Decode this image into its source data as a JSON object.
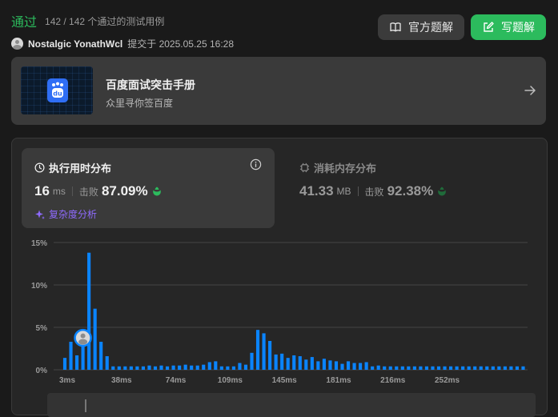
{
  "header": {
    "status": "通过",
    "passed_cases": "142 / 142 个通过的测试用例",
    "username": "Nostalgic YonathWcl",
    "submitted_at": "提交于 2025.05.25 16:28",
    "official_solution_label": "官方题解",
    "write_solution_label": "写题解"
  },
  "banner": {
    "title": "百度面试突击手册",
    "subtitle": "众里寻你签百度",
    "logo_text": "du"
  },
  "runtime": {
    "title": "执行用时分布",
    "value": "16",
    "unit": "ms",
    "beat_label": "击败",
    "beat_percent": "87.09%",
    "analysis_label": "复杂度分析"
  },
  "memory": {
    "title": "消耗内存分布",
    "value": "41.33",
    "unit": "MB",
    "beat_label": "击败",
    "beat_percent": "92.38%"
  },
  "colors": {
    "accent_green": "#2cbb5d",
    "bar_blue": "#0a84ff",
    "analysis_purple": "#8f6bff"
  },
  "chart_data": {
    "type": "bar",
    "title": "",
    "xlabel": "",
    "ylabel": "",
    "y_tick_labels": [
      "0%",
      "5%",
      "10%",
      "15%"
    ],
    "y_ticks": [
      0,
      5,
      10,
      15
    ],
    "ylim": [
      0,
      15
    ],
    "x_tick_labels": [
      "3ms",
      "38ms",
      "74ms",
      "109ms",
      "145ms",
      "181ms",
      "216ms",
      "252ms"
    ],
    "x_tick_positions": [
      0,
      9,
      18,
      27,
      36,
      45,
      54,
      63
    ],
    "grid": true,
    "marker_bar_index": 3,
    "values": [
      1.4,
      3.3,
      1.7,
      3.1,
      13.8,
      7.2,
      3.3,
      1.6,
      0.4,
      0.4,
      0.4,
      0.4,
      0.4,
      0.4,
      0.5,
      0.4,
      0.5,
      0.4,
      0.5,
      0.5,
      0.6,
      0.5,
      0.5,
      0.6,
      0.9,
      1.0,
      0.4,
      0.4,
      0.4,
      0.8,
      0.6,
      2.0,
      4.7,
      4.3,
      3.4,
      1.8,
      1.9,
      1.4,
      1.7,
      1.6,
      1.2,
      1.5,
      1.0,
      1.3,
      1.1,
      1.0,
      0.7,
      1.0,
      0.8,
      0.8,
      0.9,
      0.4,
      0.5,
      0.4,
      0.4,
      0.4,
      0.4,
      0.4,
      0.4,
      0.4,
      0.4,
      0.4,
      0.4,
      0.4,
      0.4,
      0.4,
      0.4,
      0.4,
      0.4,
      0.4,
      0.4,
      0.4,
      0.4,
      0.4,
      0.4,
      0.4,
      0.4
    ]
  }
}
